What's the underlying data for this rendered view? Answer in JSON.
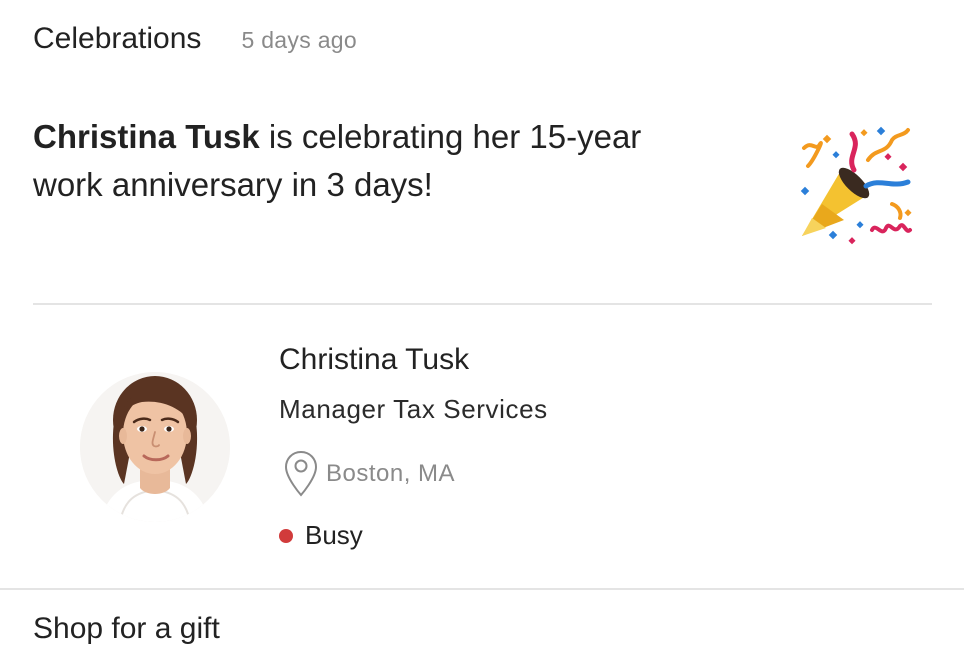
{
  "header": {
    "title": "Celebrations",
    "time": "5 days ago"
  },
  "message": {
    "name": "Christina Tusk",
    "text_line1": " is celebrating her 15-year",
    "text_line2": "work anniversary in 3 days!"
  },
  "decoration": {
    "icon": "party-popper-icon"
  },
  "profile": {
    "name": "Christina Tusk",
    "title": "Manager Tax Services",
    "location": "Boston, MA",
    "location_icon": "map-pin-icon",
    "status": "Busy",
    "status_color": "#d13b3b"
  },
  "footer": {
    "link": "Shop for a gift"
  }
}
